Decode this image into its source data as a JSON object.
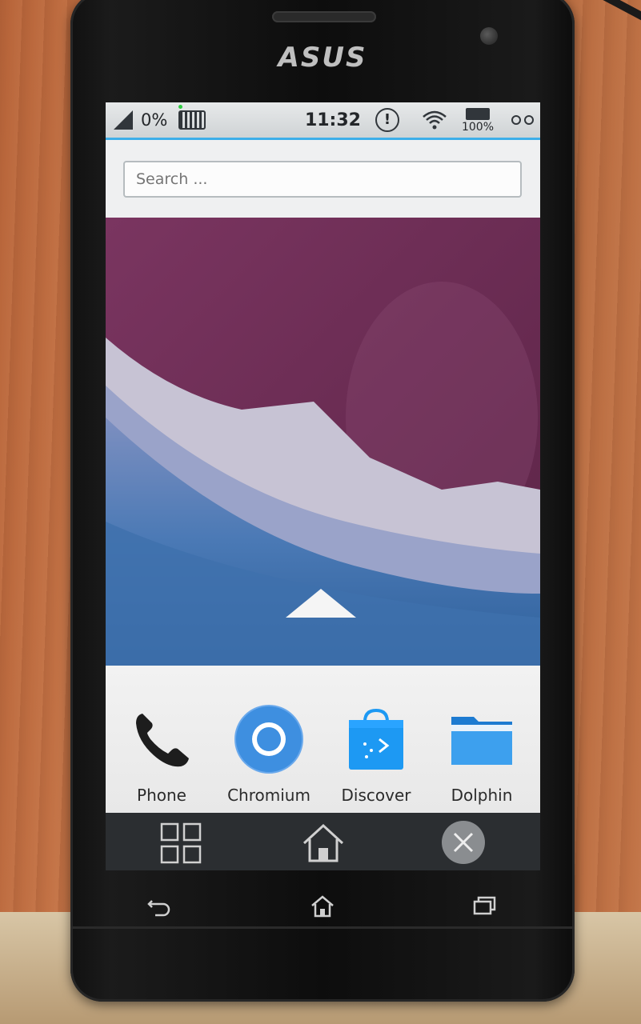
{
  "device": {
    "brand": "ASUS"
  },
  "statusbar": {
    "signal_icon": "cell-signal-icon",
    "signal_percent": "0%",
    "keyboard_icon": "keyboard-icon",
    "time": "11:32",
    "notification_icon": "warning-icon",
    "notification_glyph": "!",
    "wifi_icon": "wifi-icon",
    "battery_percent": "100%",
    "menu_icon": "overflow-menu-icon"
  },
  "search": {
    "placeholder": "Search ..."
  },
  "launcher": {
    "drawer_arrow_icon": "up-arrow-icon"
  },
  "dock": {
    "apps": [
      {
        "label": "Phone",
        "icon": "phone-icon"
      },
      {
        "label": "Chromium",
        "icon": "chromium-icon"
      },
      {
        "label": "Discover",
        "icon": "discover-icon"
      },
      {
        "label": "Dolphin",
        "icon": "folder-icon"
      }
    ]
  },
  "navpanel": {
    "app_grid_icon": "app-grid-icon",
    "home_icon": "home-icon",
    "close_icon": "close-icon"
  },
  "hardware_keys": [
    "back-icon",
    "home-icon",
    "recent-apps-icon"
  ],
  "colors": {
    "accent": "#3daee9",
    "wallpaper_purple": "#6d2e55",
    "wallpaper_blue": "#3b6fa8",
    "nav_panel": "#2b2e31"
  }
}
